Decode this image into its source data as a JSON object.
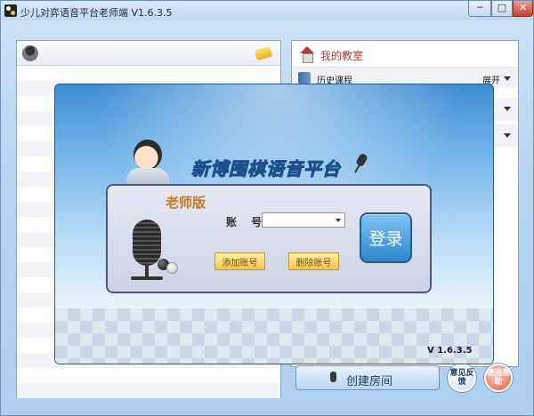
{
  "window": {
    "title": "少儿对弈语音平台老师端 V1.6.3.5",
    "min_glyph": "─",
    "max_glyph": "□",
    "close_glyph": "✕"
  },
  "right_panel": {
    "title": "我的教室",
    "history_label": "历史课程",
    "expand_label": "展开"
  },
  "bottom": {
    "create_room": "创建房间",
    "feedback": "意见反馈",
    "help": "使用帮助"
  },
  "dialog": {
    "title": "新博围棋语音平台",
    "edition": "老师版",
    "account_label": "账 号",
    "account_value": "",
    "add_account": "添加账号",
    "delete_account": "删除账号",
    "login": "登录",
    "version": "V 1.6.3.5"
  },
  "colors": {
    "accent": "#2e86cc",
    "title_red": "#c0392b",
    "edition_orange": "#c67a1e"
  }
}
